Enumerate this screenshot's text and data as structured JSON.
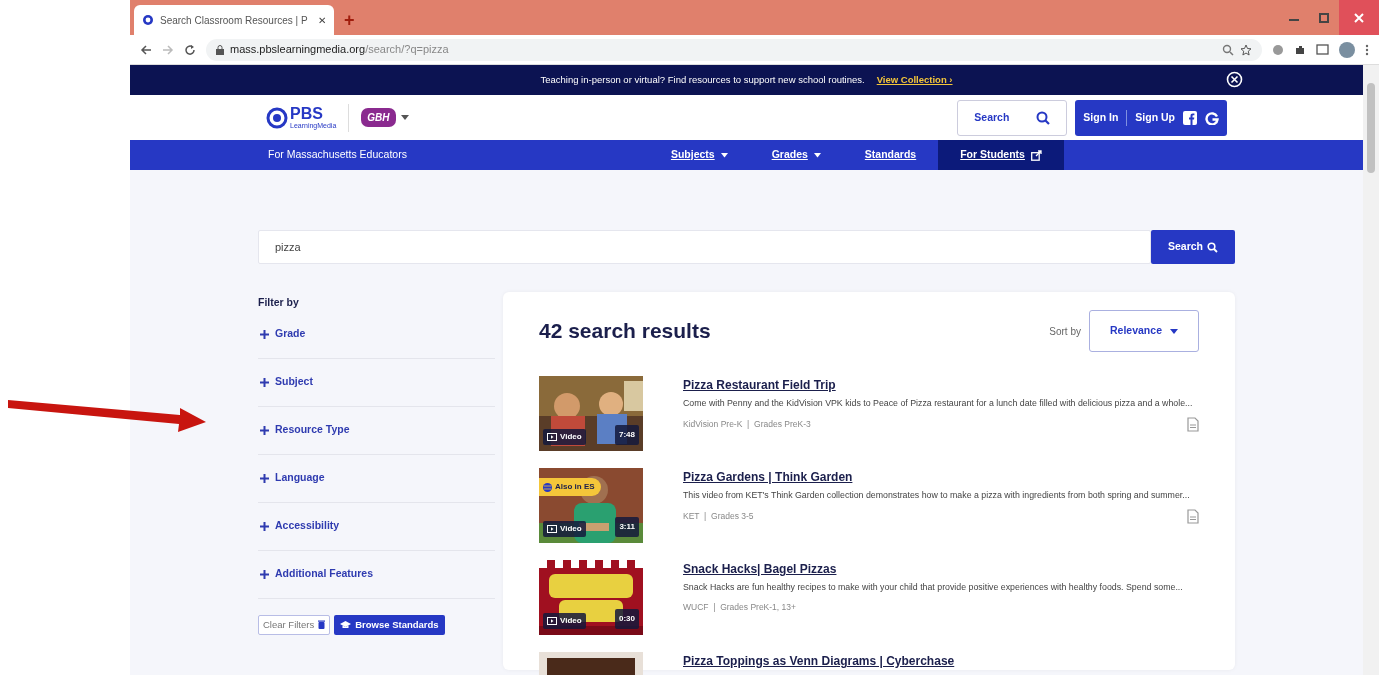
{
  "browser": {
    "tab_title": "Search Classroom Resources | P",
    "close_tab": "✕",
    "new_tab": "+",
    "url_host": "mass.pbslearningmedia.org",
    "url_path": "/search/?q=pizza"
  },
  "banner": {
    "text": "Teaching in-person or virtual? Find resources to support new school routines.",
    "link": "View Collection ›"
  },
  "header": {
    "logo_main": "PBS",
    "logo_sub": "LearningMedia",
    "station": "GBH",
    "search_label": "Search",
    "sign_in": "Sign In",
    "sign_up": "Sign Up"
  },
  "nav": {
    "region": "For Massachusetts Educators",
    "items": [
      {
        "label": "Subjects",
        "dropdown": true,
        "selected": false,
        "external": false
      },
      {
        "label": "Grades",
        "dropdown": true,
        "selected": false,
        "external": false
      },
      {
        "label": "Standards",
        "dropdown": false,
        "selected": false,
        "external": false
      },
      {
        "label": "For Students",
        "dropdown": false,
        "selected": true,
        "external": true
      }
    ]
  },
  "search": {
    "value": "pizza",
    "button": "Search"
  },
  "filters": {
    "title": "Filter by",
    "items": [
      {
        "label": "Grade",
        "expanded": false
      },
      {
        "label": "Subject",
        "expanded": false
      },
      {
        "label": "Resource Type",
        "expanded": false
      },
      {
        "label": "Language",
        "expanded": false
      },
      {
        "label": "Accessibility",
        "expanded": false
      },
      {
        "label": "Additional Features",
        "expanded": false
      }
    ],
    "clear": "Clear Filters",
    "browse": "Browse Standards"
  },
  "results": {
    "count": "42 search results",
    "sort_label": "Sort by",
    "sort_value": "Relevance",
    "items": [
      {
        "title": "Pizza Restaurant Field Trip",
        "description": "Come with Penny and the KidVision VPK kids to Peace of Pizza restaurant for a lunch date filled with delicious pizza and a whole...",
        "meta": "KidVision Pre-K  |  Grades PreK-3",
        "media": "Video",
        "duration": "7:48",
        "document_icon": true
      },
      {
        "title": "Pizza Gardens | Think Garden",
        "description": "This video from KET's Think Garden collection demonstrates how to make a pizza with ingredients from both spring and summer...",
        "meta": "KET  |  Grades 3-5",
        "media": "Video",
        "duration": "3:11",
        "also_in": "Also in ES",
        "document_icon": true
      },
      {
        "title": "Snack Hacks| Bagel Pizzas",
        "description": "Snack Hacks are fun healthy recipes to make with your child that provide positive experiences with healthy foods. Spend some...",
        "meta": "WUCF  |  Grades PreK-1, 13+",
        "media": "Video",
        "duration": "0:30",
        "document_icon": false
      },
      {
        "title": "Pizza Toppings as Venn Diagrams | Cyberchase"
      }
    ]
  }
}
